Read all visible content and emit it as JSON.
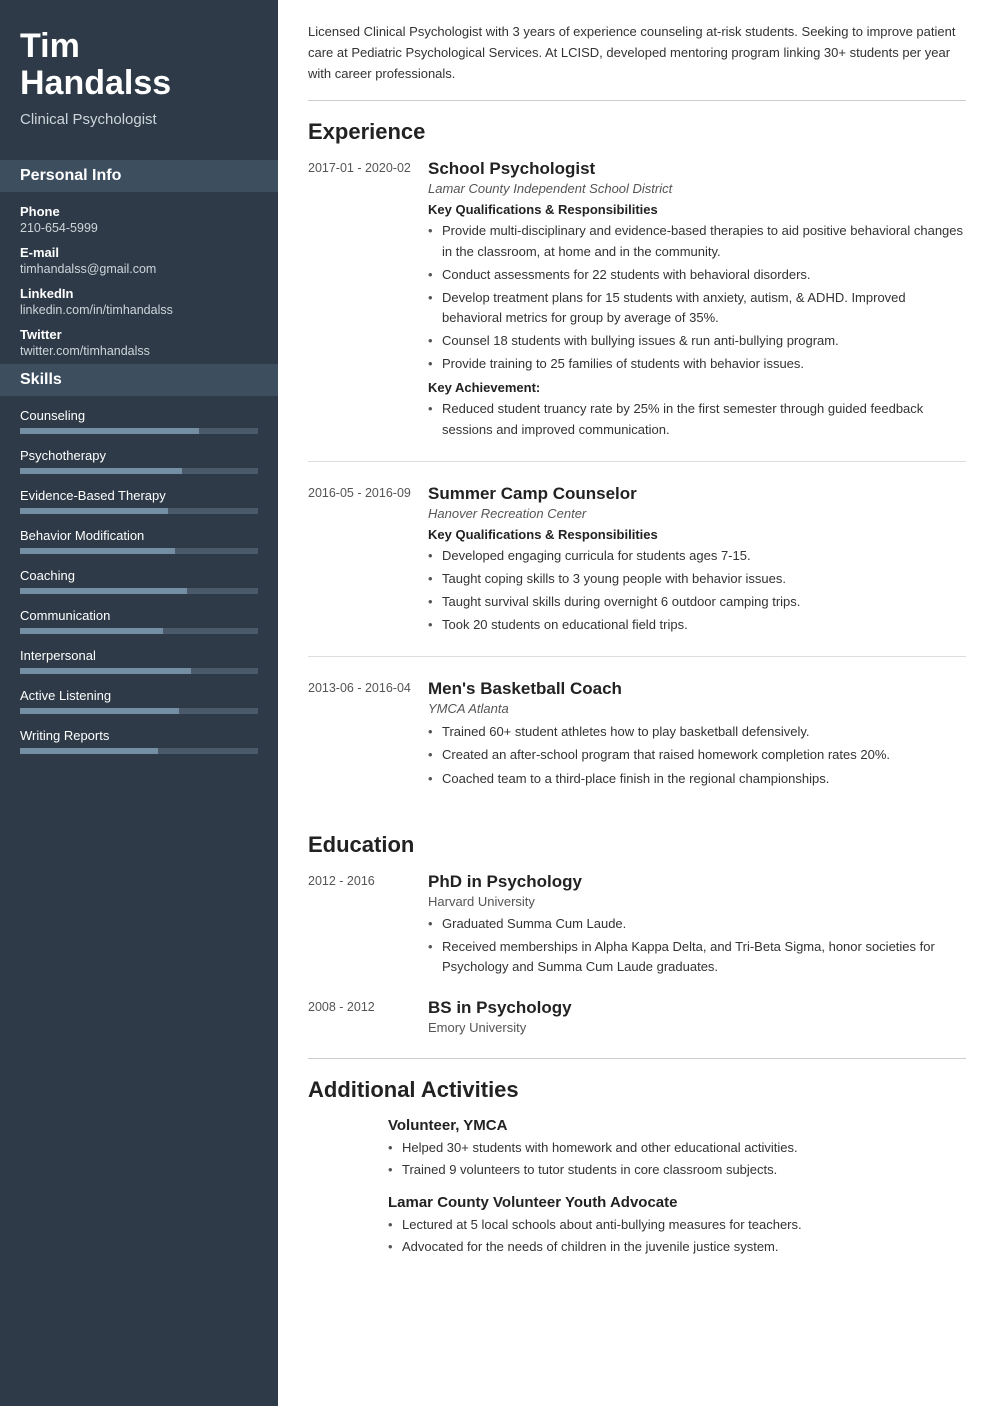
{
  "sidebar": {
    "name_line1": "Tim",
    "name_line2": "Handalss",
    "job_title": "Clinical Psychologist",
    "personal_info": {
      "title": "Personal Info",
      "phone_label": "Phone",
      "phone": "210-654-5999",
      "email_label": "E-mail",
      "email": "timhandalss@gmail.com",
      "linkedin_label": "LinkedIn",
      "linkedin": "linkedin.com/in/timhandalss",
      "twitter_label": "Twitter",
      "twitter": "twitter.com/timhandalss"
    },
    "skills": {
      "title": "Skills",
      "items": [
        {
          "name": "Counseling",
          "pct": 75
        },
        {
          "name": "Psychotherapy",
          "pct": 68
        },
        {
          "name": "Evidence-Based Therapy",
          "pct": 62
        },
        {
          "name": "Behavior Modification",
          "pct": 65
        },
        {
          "name": "Coaching",
          "pct": 70
        },
        {
          "name": "Communication",
          "pct": 60
        },
        {
          "name": "Interpersonal",
          "pct": 72
        },
        {
          "name": "Active Listening",
          "pct": 67
        },
        {
          "name": "Writing Reports",
          "pct": 58
        }
      ]
    }
  },
  "main": {
    "summary": "Licensed Clinical Psychologist with 3 years of experience counseling at-risk students. Seeking to improve patient care at Pediatric Psychological Services. At LCISD, developed mentoring program linking 30+ students per year with career professionals.",
    "experience_title": "Experience",
    "experience": [
      {
        "date": "2017-01 - 2020-02",
        "job_title": "School Psychologist",
        "company": "Lamar County Independent School District",
        "qualifications_label": "Key Qualifications & Responsibilities",
        "bullets": [
          "Provide multi-disciplinary and evidence-based therapies to aid positive behavioral changes in the classroom, at home and in the community.",
          "Conduct assessments for 22 students with behavioral disorders.",
          "Develop treatment plans for 15 students with anxiety, autism, & ADHD. Improved behavioral metrics for group by average of 35%.",
          "Counsel 18 students with bullying issues & run anti-bullying program.",
          "Provide training to 25 families of students with behavior issues."
        ],
        "achievement_label": "Key Achievement:",
        "achievement_bullets": [
          "Reduced student truancy rate by 25% in the first semester through guided feedback sessions and improved communication."
        ]
      },
      {
        "date": "2016-05 - 2016-09",
        "job_title": "Summer Camp Counselor",
        "company": "Hanover Recreation Center",
        "qualifications_label": "Key Qualifications & Responsibilities",
        "bullets": [
          "Developed engaging curricula for students ages 7-15.",
          "Taught coping skills to 3 young people with behavior issues.",
          "Taught survival skills during overnight 6 outdoor camping trips.",
          "Took 20 students on educational field trips."
        ],
        "achievement_label": null,
        "achievement_bullets": []
      },
      {
        "date": "2013-06 - 2016-04",
        "job_title": "Men's Basketball Coach",
        "company": "YMCA Atlanta",
        "qualifications_label": null,
        "bullets": [
          "Trained 60+ student athletes how to play basketball defensively.",
          "Created an after-school program that raised homework completion rates 20%.",
          "Coached team to a third-place finish in the regional championships."
        ],
        "achievement_label": null,
        "achievement_bullets": []
      }
    ],
    "education_title": "Education",
    "education": [
      {
        "date": "2012 - 2016",
        "degree": "PhD in Psychology",
        "school": "Harvard University",
        "bullets": [
          "Graduated Summa Cum Laude.",
          "Received memberships in Alpha Kappa Delta, and Tri-Beta Sigma, honor societies for Psychology and Summa Cum Laude graduates."
        ]
      },
      {
        "date": "2008 - 2012",
        "degree": "BS in Psychology",
        "school": "Emory University",
        "bullets": []
      }
    ],
    "activities_title": "Additional Activities",
    "activities": [
      {
        "title": "Volunteer, YMCA",
        "bullets": [
          "Helped 30+ students with homework and other educational activities.",
          "Trained 9 volunteers to tutor students in core classroom subjects."
        ]
      },
      {
        "title": "Lamar County Volunteer Youth Advocate",
        "bullets": [
          "Lectured at 5 local schools about anti-bullying measures for teachers.",
          "Advocated for the needs of children in the juvenile justice system."
        ]
      }
    ]
  }
}
